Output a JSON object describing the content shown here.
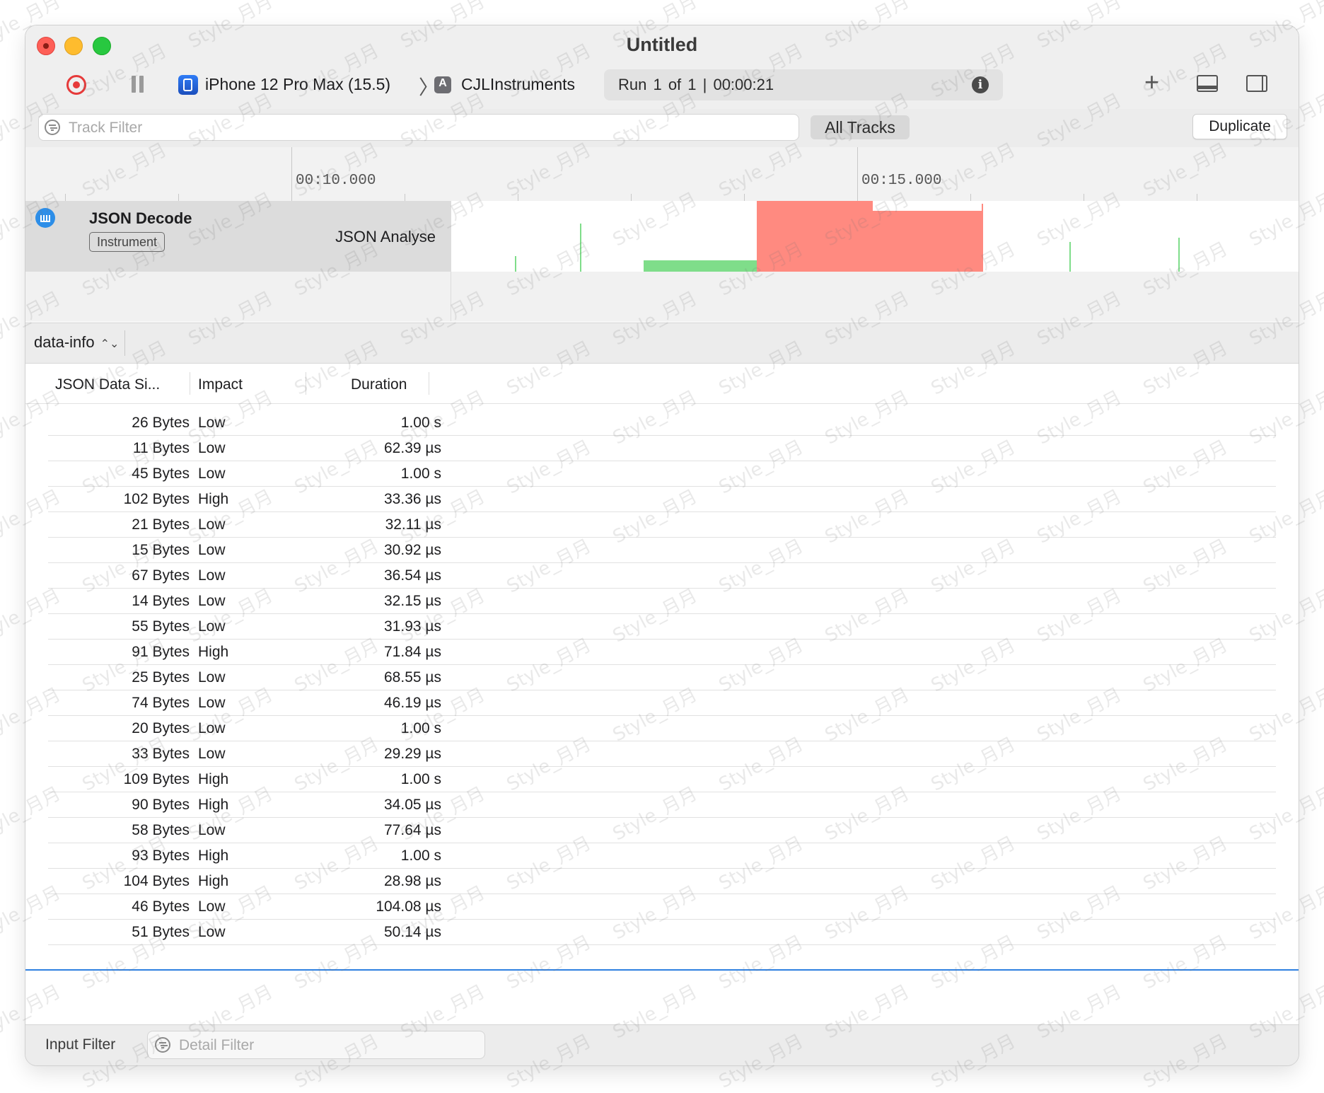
{
  "window": {
    "title": "Untitled"
  },
  "toolbar": {
    "device": "iPhone 12 Pro Max (15.5)",
    "separator": "〉",
    "app": "CJLInstruments",
    "run_info": "Run 1 of 1  |  00:00:21",
    "add_label": "+"
  },
  "filterbar": {
    "track_filter_placeholder": "Track Filter",
    "all_tracks_label": "All Tracks",
    "duplicate_label": "Duplicate"
  },
  "ruler": {
    "labels": [
      "00:10.000",
      "00:15.000"
    ]
  },
  "track": {
    "title": "JSON Decode",
    "badge": "Instrument",
    "subtitle": "JSON Analyse",
    "colors": {
      "low": "#7fdd8a",
      "high": "#ff8a80"
    }
  },
  "detail": {
    "selector": "data-info",
    "selector_icon": "⌃⌄",
    "columns": [
      "JSON Data Si...",
      "Impact",
      "Duration"
    ],
    "rows": [
      {
        "size": "26 Bytes",
        "impact": "Low",
        "duration": "1.00 s"
      },
      {
        "size": "11 Bytes",
        "impact": "Low",
        "duration": "62.39 µs"
      },
      {
        "size": "45 Bytes",
        "impact": "Low",
        "duration": "1.00 s"
      },
      {
        "size": "102 Bytes",
        "impact": "High",
        "duration": "33.36 µs"
      },
      {
        "size": "21 Bytes",
        "impact": "Low",
        "duration": "32.11 µs"
      },
      {
        "size": "15 Bytes",
        "impact": "Low",
        "duration": "30.92 µs"
      },
      {
        "size": "67 Bytes",
        "impact": "Low",
        "duration": "36.54 µs"
      },
      {
        "size": "14 Bytes",
        "impact": "Low",
        "duration": "32.15 µs"
      },
      {
        "size": "55 Bytes",
        "impact": "Low",
        "duration": "31.93 µs"
      },
      {
        "size": "91 Bytes",
        "impact": "High",
        "duration": "71.84 µs"
      },
      {
        "size": "25 Bytes",
        "impact": "Low",
        "duration": "68.55 µs"
      },
      {
        "size": "74 Bytes",
        "impact": "Low",
        "duration": "46.19 µs"
      },
      {
        "size": "20 Bytes",
        "impact": "Low",
        "duration": "1.00 s"
      },
      {
        "size": "33 Bytes",
        "impact": "Low",
        "duration": "29.29 µs"
      },
      {
        "size": "109 Bytes",
        "impact": "High",
        "duration": "1.00 s"
      },
      {
        "size": "90 Bytes",
        "impact": "High",
        "duration": "34.05 µs"
      },
      {
        "size": "58 Bytes",
        "impact": "Low",
        "duration": "77.64 µs"
      },
      {
        "size": "93 Bytes",
        "impact": "High",
        "duration": "1.00 s"
      },
      {
        "size": "104 Bytes",
        "impact": "High",
        "duration": "28.98 µs"
      },
      {
        "size": "46 Bytes",
        "impact": "Low",
        "duration": "104.08 µs"
      },
      {
        "size": "51 Bytes",
        "impact": "Low",
        "duration": "50.14 µs"
      }
    ]
  },
  "bottom": {
    "input_filter_label": "Input Filter",
    "detail_filter_placeholder": "Detail Filter"
  },
  "watermark": "Style_月月",
  "icons": {
    "close": "close-icon",
    "minimize": "minimize-icon",
    "zoom": "zoom-icon",
    "record": "record-icon",
    "pause": "pause-icon",
    "info": "info-icon",
    "add": "plus-icon",
    "bottom_panel": "bottom-panel-icon",
    "right_panel": "right-panel-icon",
    "filter": "filter-icon"
  }
}
